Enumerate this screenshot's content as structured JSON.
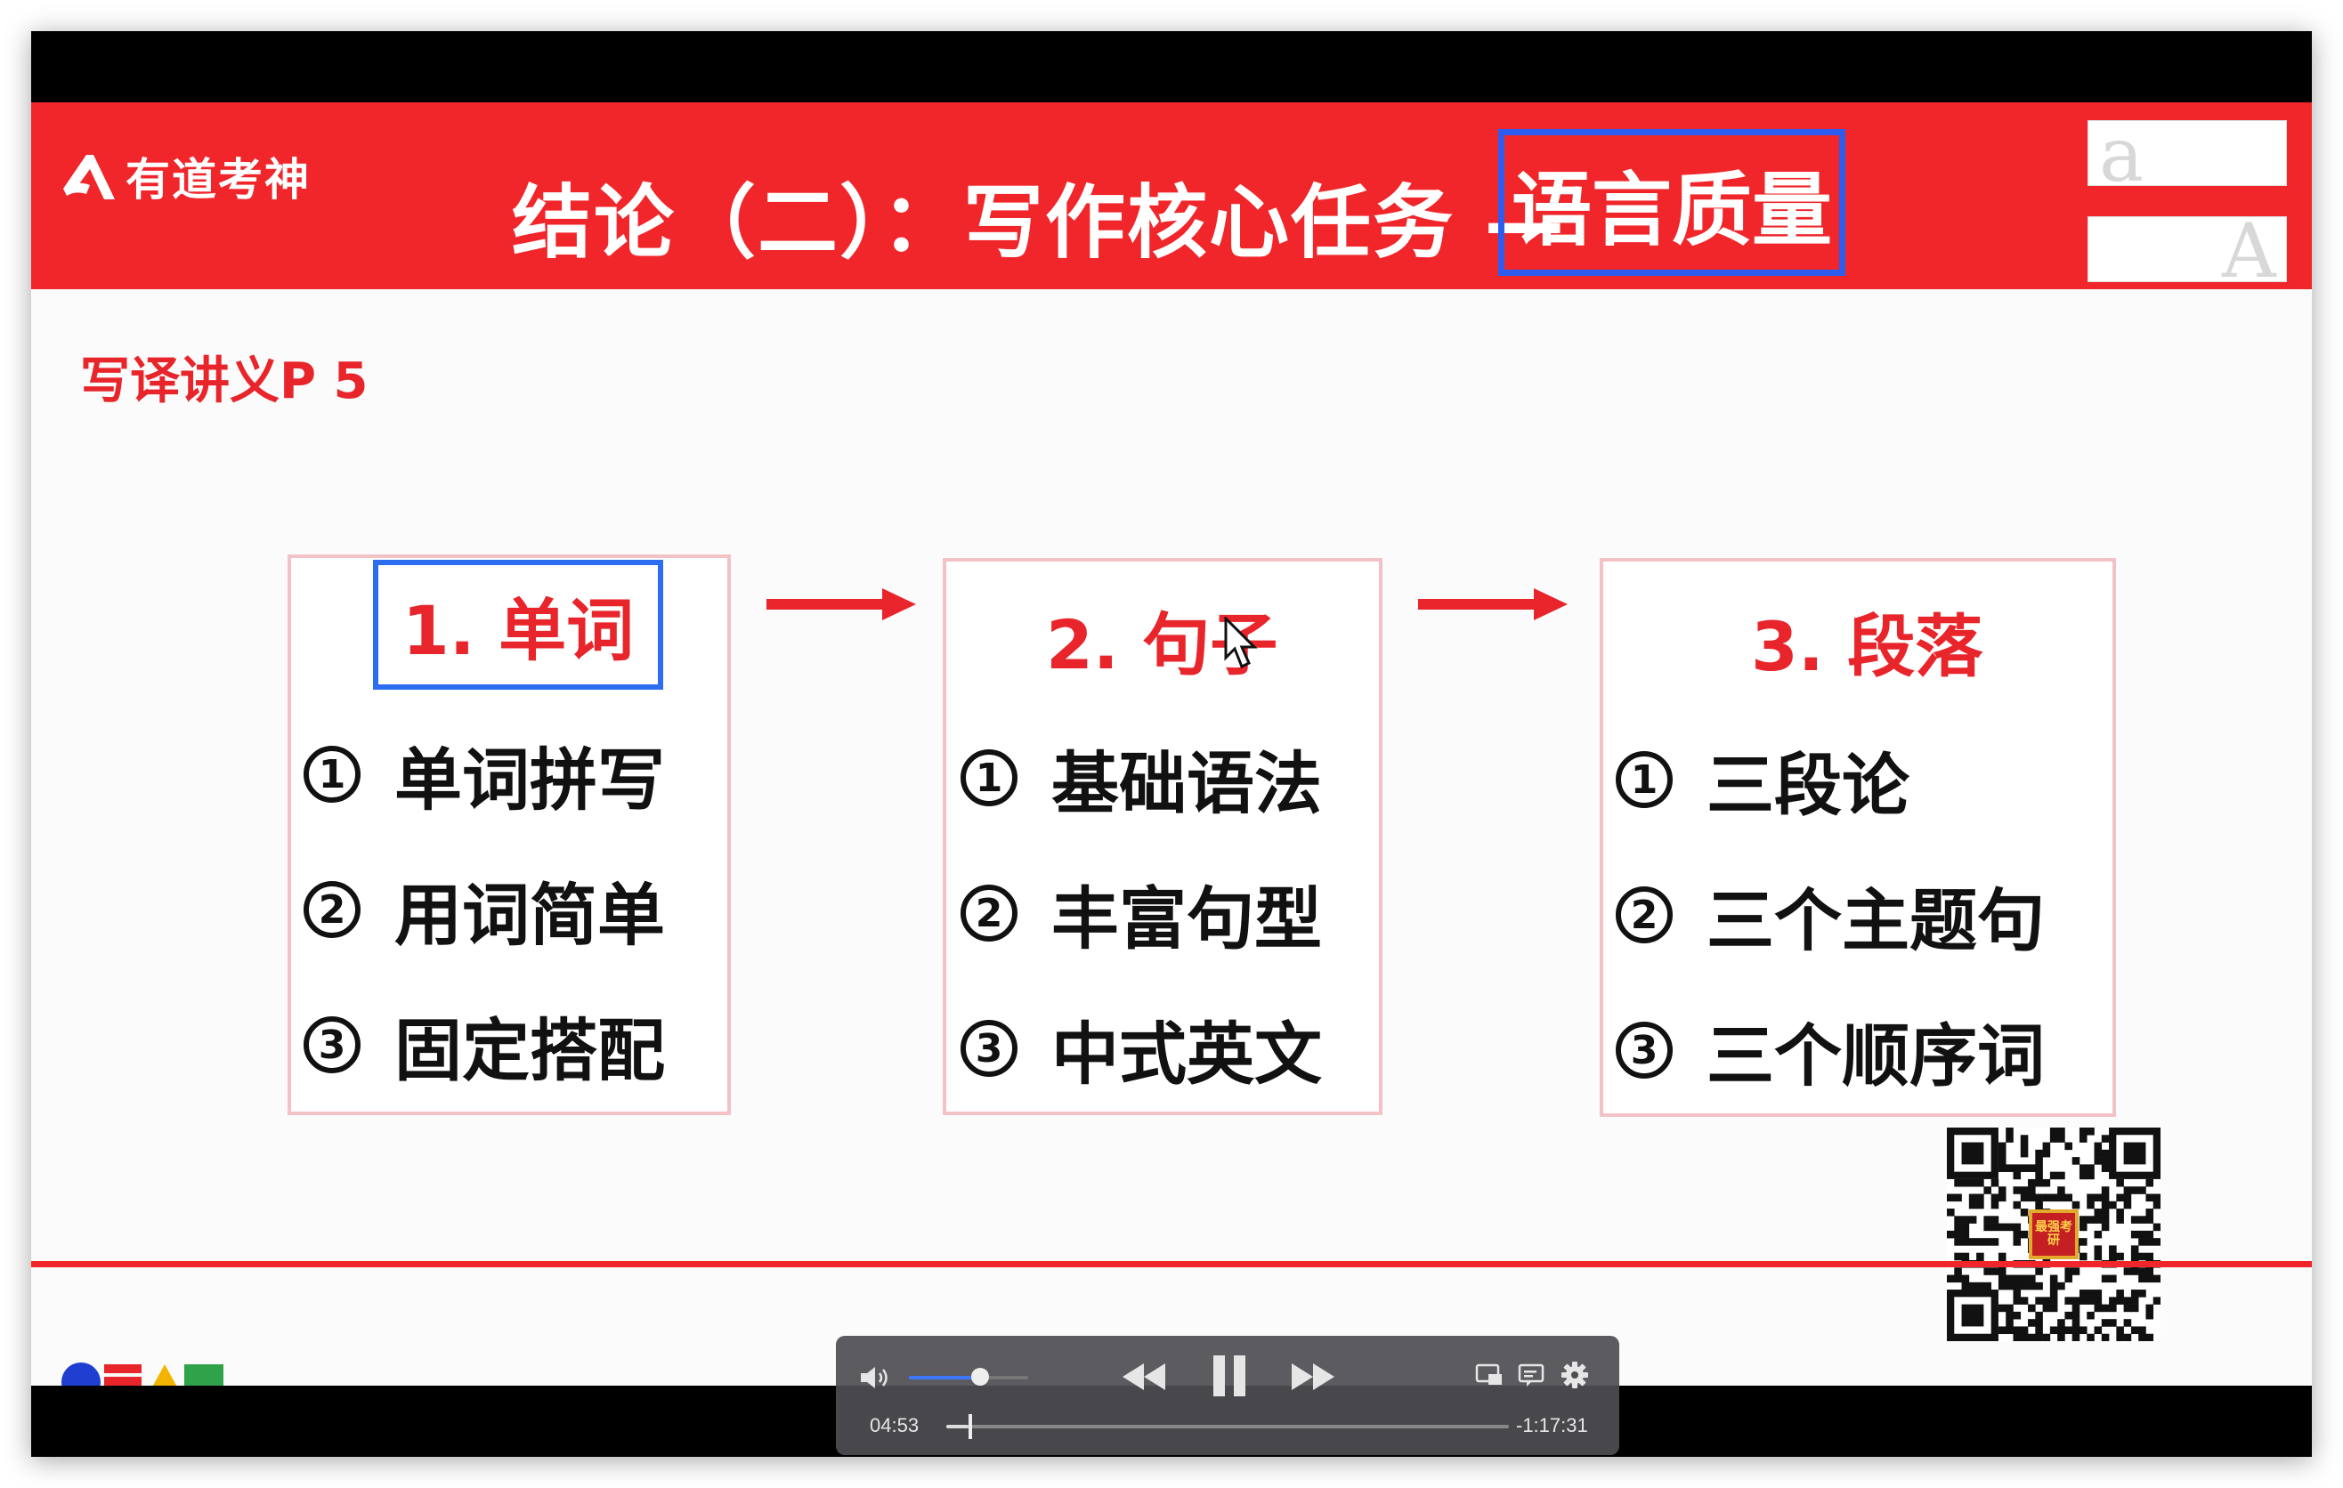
{
  "slide": {
    "logo_text": "有道考神",
    "title": "结论（二）：写作核心任务 —",
    "title_highlight": "语言质量",
    "font_size_glyphs": [
      "a",
      "A"
    ],
    "handout_ref": "写译讲义P 5",
    "steps": [
      {
        "heading": "1.  单词",
        "items": [
          {
            "num": "1",
            "text": "单词拼写"
          },
          {
            "num": "2",
            "text": "用词简单"
          },
          {
            "num": "3",
            "text": "固定搭配"
          }
        ]
      },
      {
        "heading": "2.  句子",
        "items": [
          {
            "num": "1",
            "text": "基础语法"
          },
          {
            "num": "2",
            "text": "丰富句型"
          },
          {
            "num": "3",
            "text": "中式英文"
          }
        ]
      },
      {
        "heading": "3. 段落",
        "items": [
          {
            "num": "1",
            "text": "三段论"
          },
          {
            "num": "2",
            "text": "三个主题句"
          },
          {
            "num": "3",
            "text": "三个顺序词"
          }
        ]
      }
    ],
    "qr_badge": "最强考研",
    "accent_color": "#f0262b",
    "highlight_border_color": "#2d5cf0"
  },
  "player": {
    "current_time": "04:53",
    "remaining_time": "-1:17:31",
    "progress_fraction": 0.04,
    "volume_fraction": 0.6,
    "state": "playing",
    "icons": [
      "volume-icon",
      "rewind-icon",
      "pause-icon",
      "fast-forward-icon",
      "picture-in-picture-icon",
      "subtitles-icon",
      "settings-icon"
    ]
  }
}
